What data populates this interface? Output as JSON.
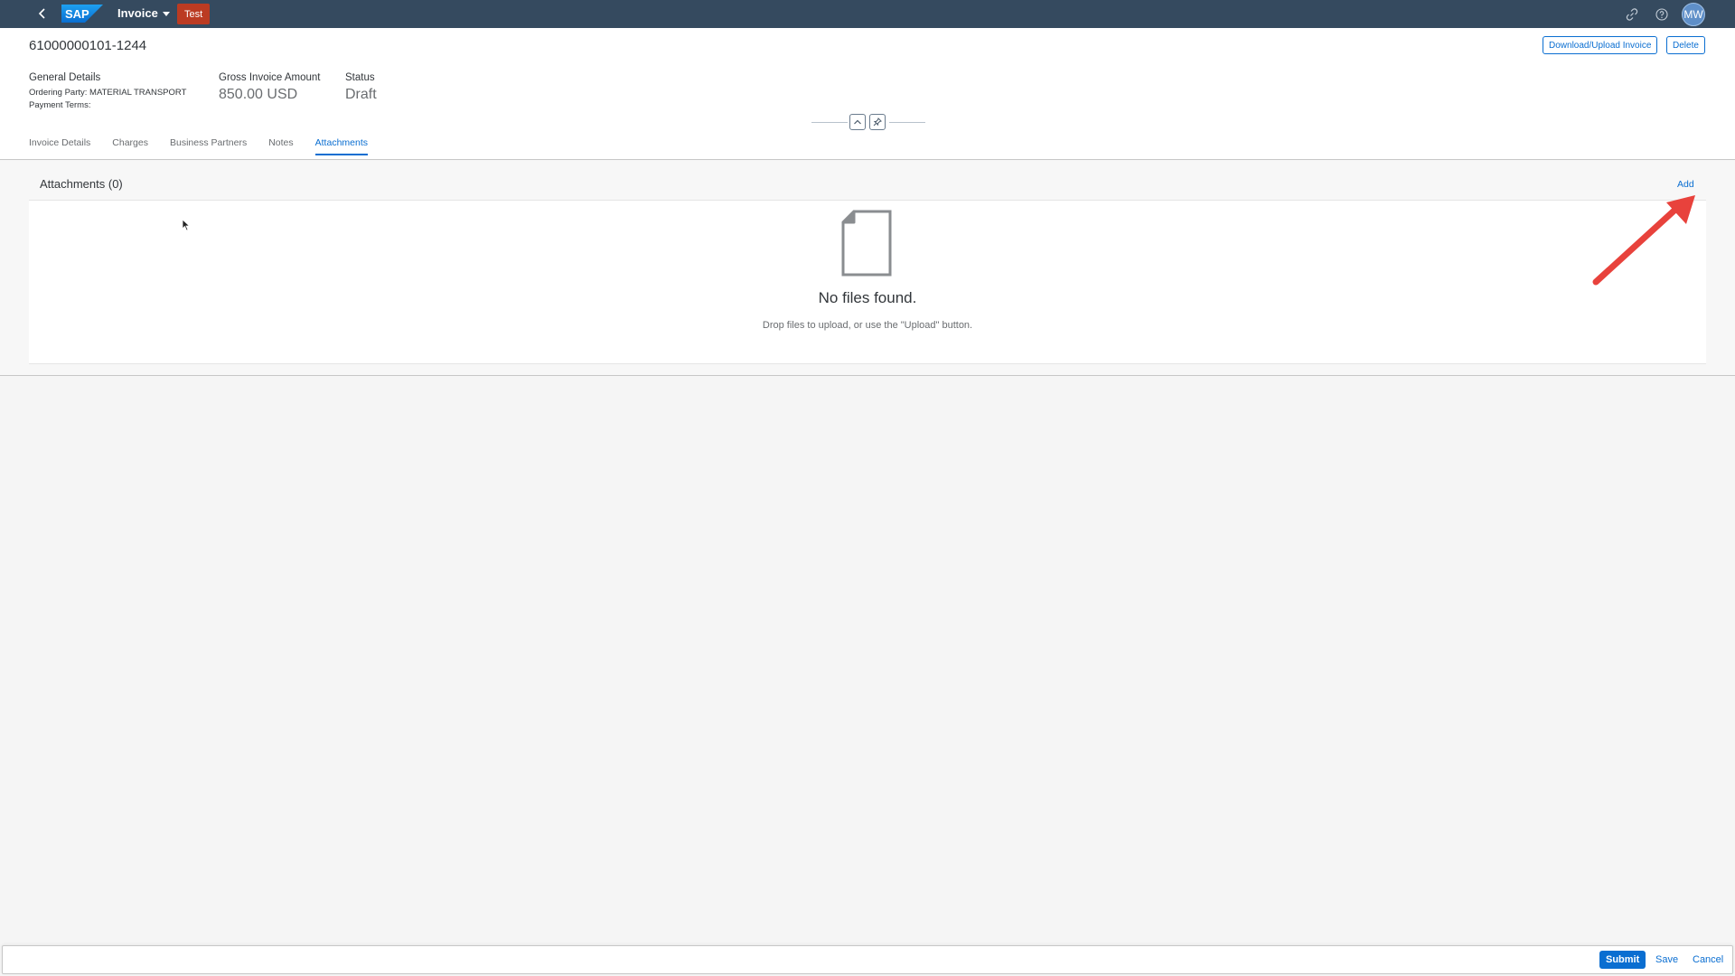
{
  "shell": {
    "logo_text": "SAP",
    "app_title": "Invoice",
    "environment_badge": "Test",
    "user_initials": "MW",
    "icons": [
      "back-icon",
      "link-icon",
      "help-icon"
    ]
  },
  "header": {
    "object_title": "61000000101-1244",
    "actions": {
      "download_upload": "Download/Upload Invoice",
      "delete": "Delete"
    },
    "general_details": {
      "title": "General Details",
      "ordering_party": "Ordering Party: MATERIAL TRANSPORT",
      "payment_terms": "Payment Terms:"
    },
    "gross_amount": {
      "title": "Gross Invoice Amount",
      "value": "850.00 USD"
    },
    "status": {
      "title": "Status",
      "value": "Draft"
    },
    "tabs": [
      {
        "label": "Invoice Details"
      },
      {
        "label": "Charges"
      },
      {
        "label": "Business Partners"
      },
      {
        "label": "Notes"
      },
      {
        "label": "Attachments",
        "active": true
      }
    ]
  },
  "attachments": {
    "title": "Attachments (0)",
    "add_label": "Add",
    "empty_title": "No files found.",
    "empty_description": "Drop files to upload, or use the \"Upload\" button."
  },
  "footer": {
    "submit_label": "Submit",
    "save_label": "Save",
    "cancel_label": "Cancel"
  },
  "colors": {
    "shell_bg": "#354a5f",
    "accent": "#0a6ed1",
    "badge": "#bb3b22",
    "annotation_arrow": "#e8423c"
  }
}
